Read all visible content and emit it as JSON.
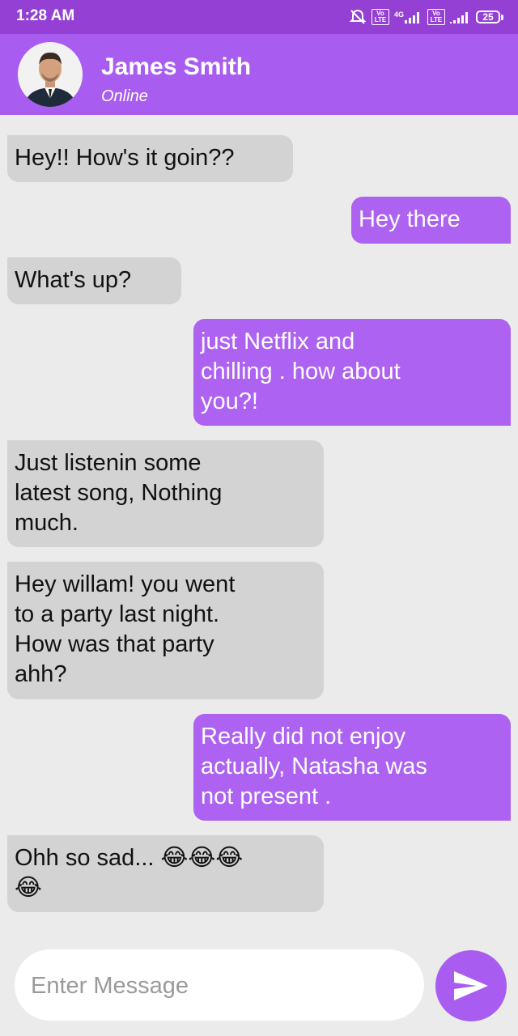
{
  "status_bar": {
    "time": "1:28 AM",
    "network_label": "4G",
    "lte_label": "Vo LTE",
    "battery_level": "25",
    "icons": [
      "alarm-off-icon",
      "volte-icon",
      "signal-icon",
      "volte-icon",
      "signal-icon",
      "battery-icon"
    ]
  },
  "header": {
    "contact_name": "James Smith",
    "contact_status": "Online",
    "avatar_icon": "avatar"
  },
  "messages": [
    {
      "direction": "received",
      "text": "Hey!! How's it goin??"
    },
    {
      "direction": "sent",
      "text": "Hey there"
    },
    {
      "direction": "received",
      "text": "What's up?"
    },
    {
      "direction": "sent",
      "text": "just Netflix and\nchilling . how about\nyou?!"
    },
    {
      "direction": "received",
      "text": "Just listenin some\nlatest song, Nothing\nmuch."
    },
    {
      "direction": "received",
      "text": "Hey willam! you went\nto a party last night.\nHow was that party\nahh?"
    },
    {
      "direction": "sent",
      "text": "Really did not enjoy\nactually, Natasha was\nnot present ."
    },
    {
      "direction": "received",
      "text": "Ohh so sad... 😂😂😂\n😂"
    }
  ],
  "composer": {
    "placeholder": "Enter Message",
    "value": "",
    "send_icon": "send-icon"
  },
  "colors": {
    "status_bar": "#9440d4",
    "header": "#a85df0",
    "sent_bubble": "#ad62f2",
    "received_bubble": "#d3d3d3",
    "background": "#ebebeb"
  }
}
